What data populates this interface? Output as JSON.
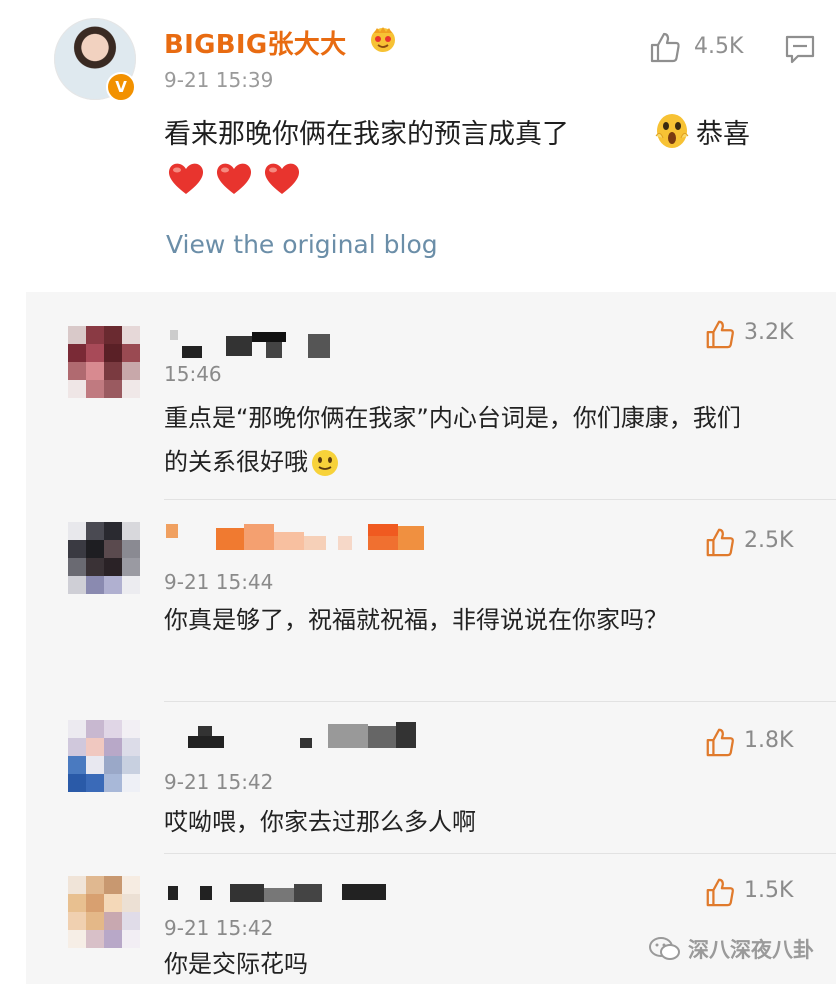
{
  "post": {
    "username": "BIGBIG张大大",
    "time": "9-21 15:39",
    "like_count": "4.5K",
    "text_part1": "看来那晚你俩在我家的预言成真了",
    "text_part2": "恭喜",
    "view_original": "View the original blog",
    "verified_badge": "V",
    "accent_color": "#e86b11"
  },
  "comments": [
    {
      "time": "15:46",
      "like_count": "3.2K",
      "text": "重点是“那晚你俩在我家”内心台词是，你们康康，我们的关系很好哦"
    },
    {
      "time": "9-21 15:44",
      "like_count": "2.5K",
      "text": "你真是够了，祝福就祝福，非得说说在你家吗？"
    },
    {
      "time": "9-21 15:42",
      "like_count": "1.8K",
      "text": "哎呦喂，你家去过那么多人啊"
    },
    {
      "time": "9-21 15:42",
      "like_count": "1.5K",
      "text": "你是交际花吗"
    }
  ],
  "watermark": {
    "text": "深八深夜八卦"
  },
  "colors": {
    "like_orange": "#e07a2c",
    "link_blue": "#6b8ea8",
    "heart_red": "#e8342e"
  }
}
